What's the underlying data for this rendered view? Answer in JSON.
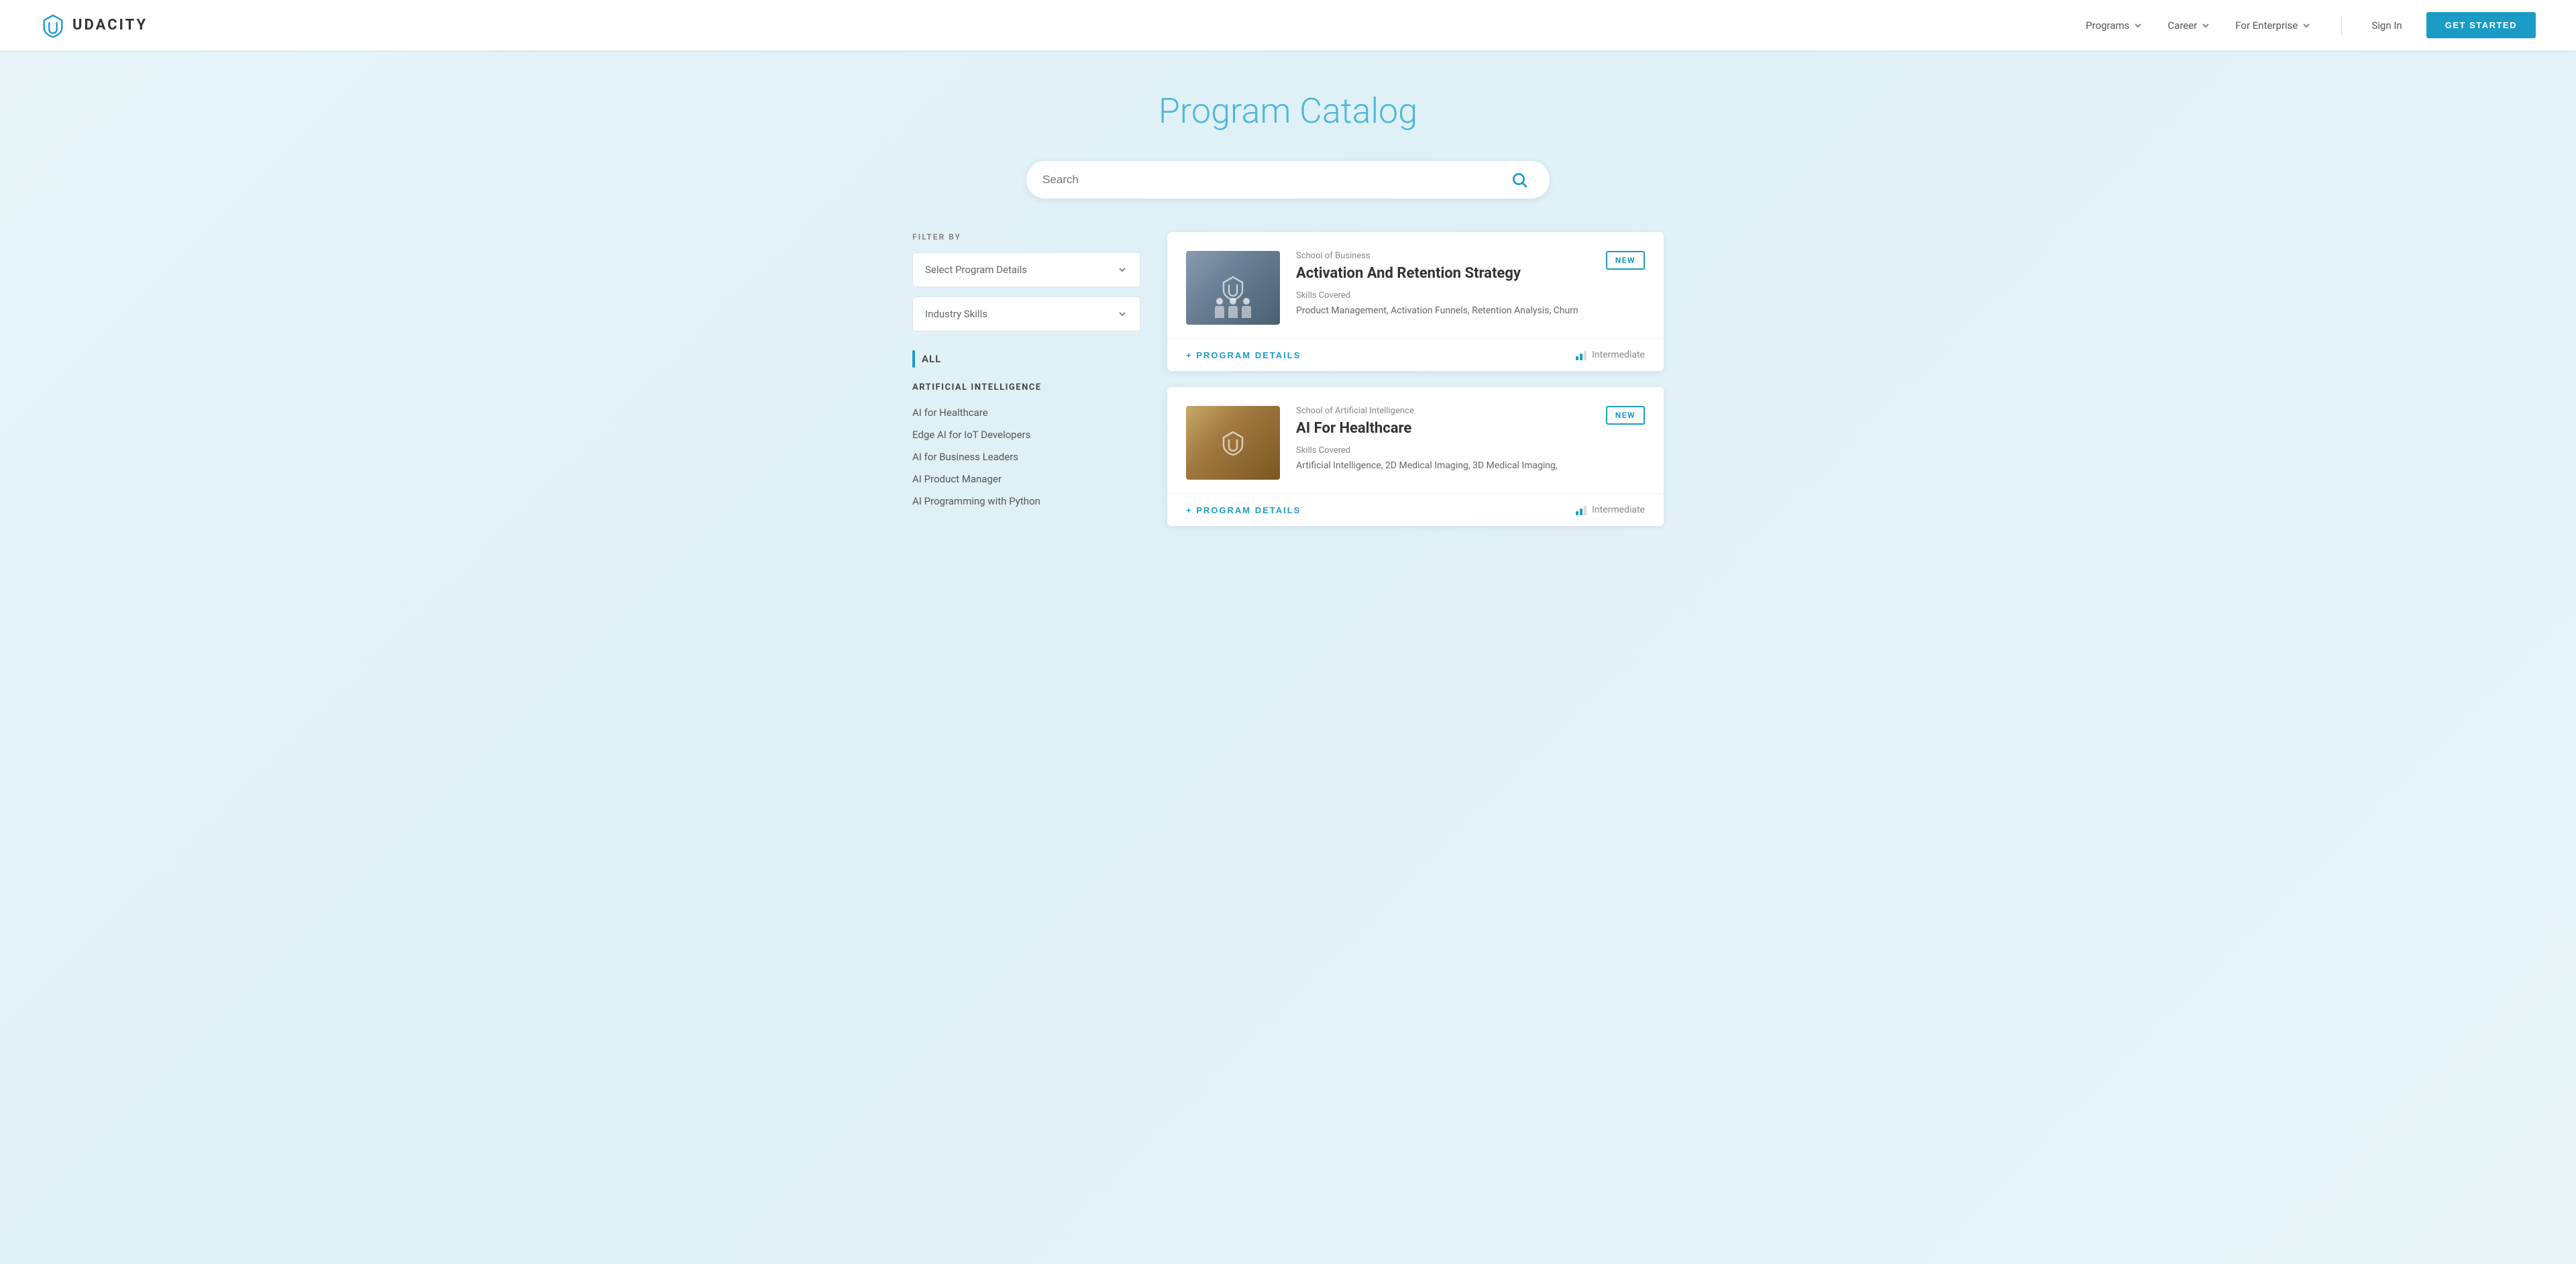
{
  "navbar": {
    "logo_text": "UDACITY",
    "nav_items": [
      {
        "label": "Programs",
        "has_dropdown": true
      },
      {
        "label": "Career",
        "has_dropdown": true
      },
      {
        "label": "For Enterprise",
        "has_dropdown": true
      }
    ],
    "signin_label": "Sign In",
    "cta_label": "GET STARTED"
  },
  "page": {
    "title": "Program Catalog"
  },
  "search": {
    "placeholder": "Search"
  },
  "sidebar": {
    "filter_label": "FILTER BY",
    "dropdown_program": "Select Program Details",
    "dropdown_industry": "Industry Skills",
    "all_label": "ALL",
    "sections": [
      {
        "title": "ARTIFICIAL INTELLIGENCE",
        "items": [
          "AI for Healthcare",
          "Edge AI for IoT Developers",
          "AI for Business Leaders",
          "AI Product Manager",
          "AI Programming with Python"
        ]
      }
    ]
  },
  "cards": [
    {
      "school": "School of Business",
      "title": "Activation And Retention Strategy",
      "badge": "NEW",
      "skills_label": "Skills Covered",
      "skills": "Product Management, Activation\nFunnels, Retention Analysis, Churn",
      "level": "Intermediate",
      "details_btn": "+ PROGRAM DETAILS",
      "thumb_type": "business"
    },
    {
      "school": "School of Artificial Intelligence",
      "title": "AI For Healthcare",
      "badge": "NEW",
      "skills_label": "Skills Covered",
      "skills": "Artificial Intelligence, 2D Medical\nImaging, 3D Medical Imaging,",
      "level": "Intermediate",
      "details_btn": "+ PROGRAM DETAILS",
      "thumb_type": "ai"
    }
  ]
}
